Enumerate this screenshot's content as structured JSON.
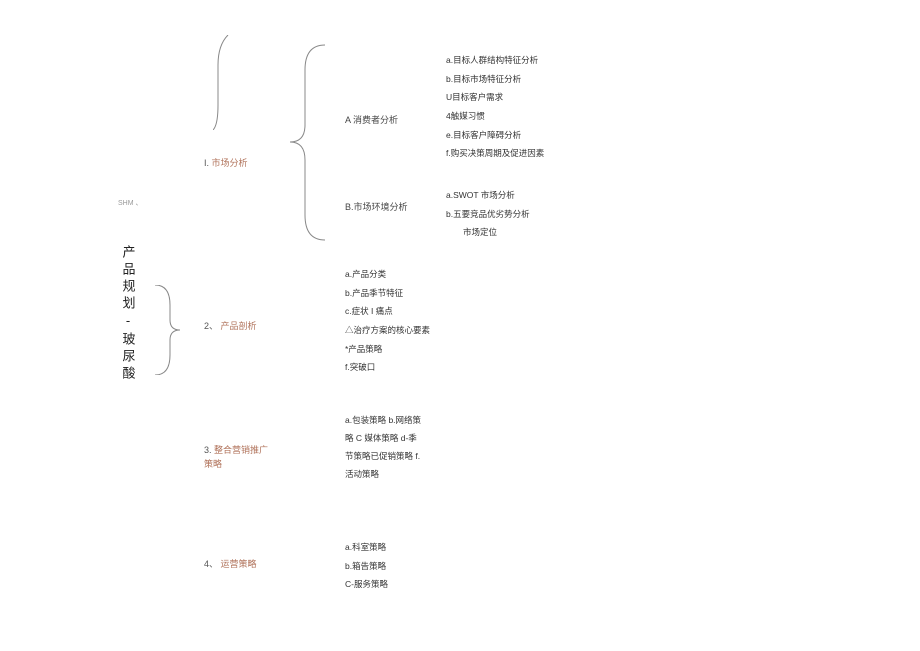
{
  "root": {
    "topmark": "SHM\n、",
    "title": "产品规划-玻尿酸"
  },
  "level2": {
    "n1": {
      "num": "I.",
      "txt": "市场分析"
    },
    "n2": {
      "num": "2、",
      "txt": "产品剖析"
    },
    "n3": {
      "num": "3.",
      "txt": "整合营销推广\n策略"
    },
    "n4": {
      "num": "4、",
      "txt": "运营策略"
    }
  },
  "level3": {
    "a": "A 消费者分析",
    "b": "B.市场环境分析"
  },
  "leaves": {
    "g1a": [
      "a.目标人群结构特征分析",
      "b.目标市场特征分析",
      "U目标客户需求",
      "4触媒习惯",
      "e.目标客户障碍分析",
      "f.购买决策周期及促进因素"
    ],
    "g1b": [
      "a.SWOT 市场分析",
      "b.五要竞品优劣势分析",
      "　　市场定位"
    ],
    "g2": [
      "a.产品分类",
      "b.产品季节特征",
      "c.症状 I 痛点",
      "△治疗方案的核心要素",
      "*产品策略",
      "f.突破口"
    ],
    "g3": "a.包装策略 b.网络策略 C 媒体策略 d-季节策略已促销策略 f.活动策略",
    "g4": [
      "a.科室策略",
      "b.箱告策略",
      "C-服务策略"
    ]
  }
}
